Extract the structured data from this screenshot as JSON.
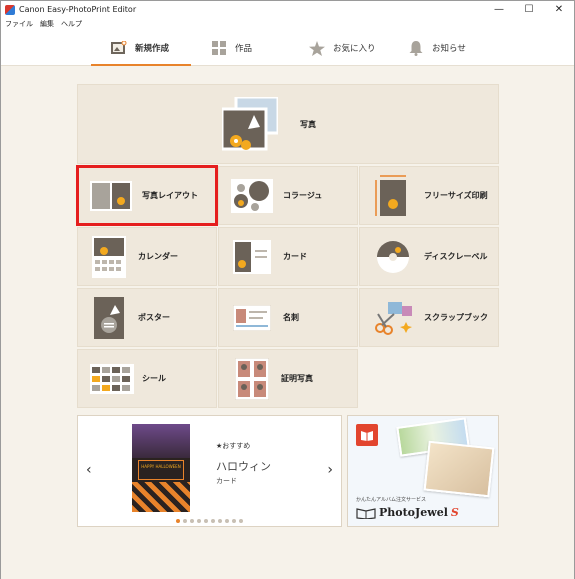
{
  "window": {
    "title": "Canon Easy-PhotoPrint Editor",
    "controls": [
      "—",
      "☐",
      "✕"
    ]
  },
  "menu": [
    "ファイル",
    "編集",
    "ヘルプ"
  ],
  "nav": {
    "tabs": [
      {
        "label": "新規作成",
        "icon": "new-create-icon",
        "active": true
      },
      {
        "label": "作品",
        "icon": "grid-icon",
        "active": false
      },
      {
        "label": "お気に入り",
        "icon": "star-icon",
        "active": false
      },
      {
        "label": "お知らせ",
        "icon": "bell-icon",
        "active": false
      }
    ],
    "accent": "#e8832b"
  },
  "tiles": {
    "photo": "写真",
    "photo_layout": "写真レイアウト",
    "collage": "コラージュ",
    "free_size": "フリーサイズ印刷",
    "calendar": "カレンダー",
    "card": "カード",
    "disc_label": "ディスクレーベル",
    "poster": "ポスター",
    "business_card": "名刺",
    "scrapbook": "スクラップブック",
    "sticker": "シール",
    "id_photo": "証明写真"
  },
  "banner_left": {
    "recommend": "★おすすめ",
    "title": "ハロウィン",
    "subtitle": "カード",
    "card_text": "HAPPY HALLOWEEN",
    "prev": "‹",
    "next": "›",
    "page_count": 10,
    "active_page": 1
  },
  "banner_right": {
    "tagline": "かんたんアルバム注文サービス",
    "brand": "PhotoJewel",
    "brand_suffix": "S"
  },
  "colors": {
    "highlight": "#e51e1e",
    "tile_bg": "#efe8dc",
    "flower": "#f3a91f",
    "mountain": "#6b6258"
  }
}
